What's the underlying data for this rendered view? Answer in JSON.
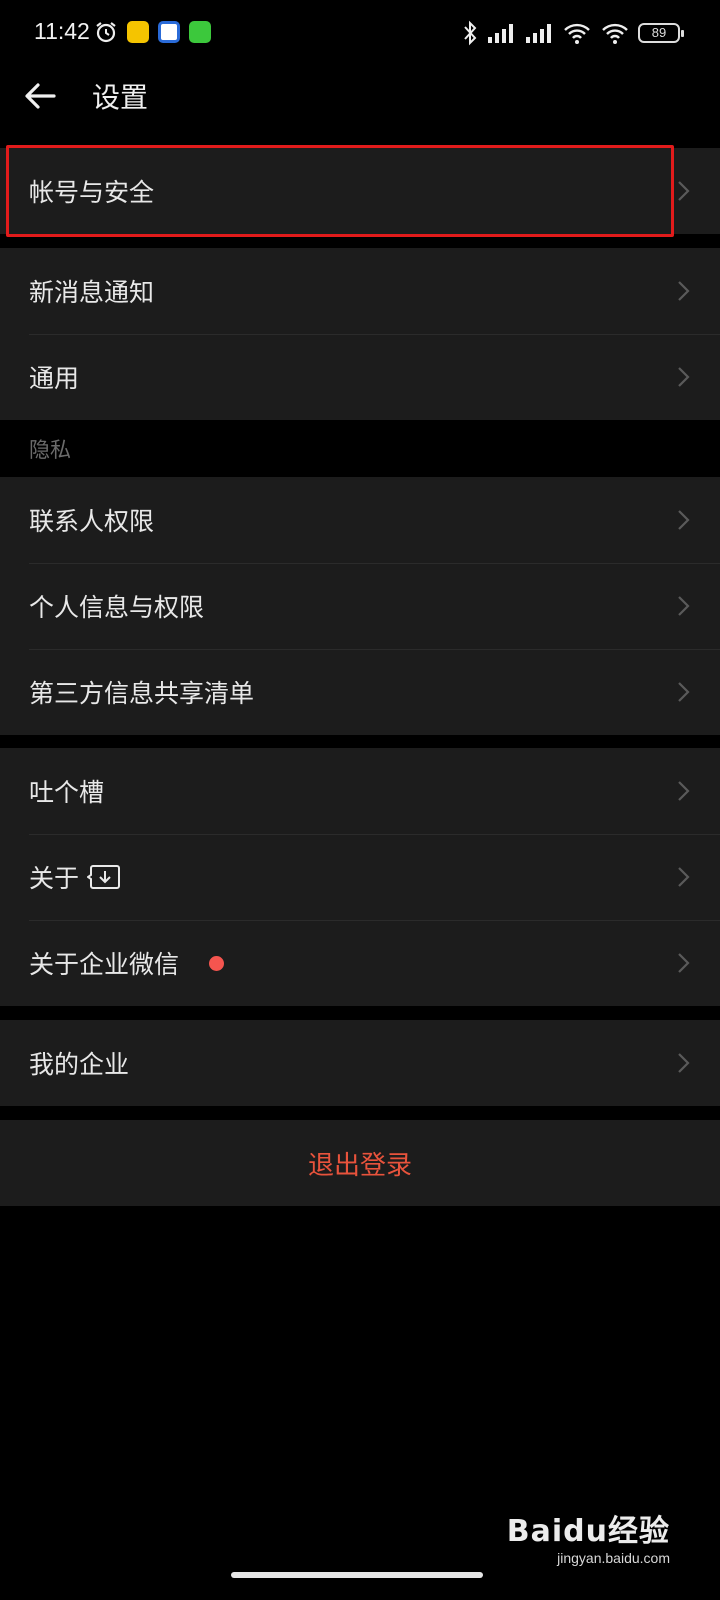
{
  "status_bar": {
    "time": "11:42",
    "battery": "89"
  },
  "header": {
    "title": "设置"
  },
  "groups": [
    {
      "items": [
        {
          "label": "帐号与安全"
        }
      ]
    },
    {
      "items": [
        {
          "label": "新消息通知"
        },
        {
          "label": "通用"
        }
      ]
    },
    {
      "section": "隐私",
      "items": [
        {
          "label": "联系人权限"
        },
        {
          "label": "个人信息与权限"
        },
        {
          "label": "第三方信息共享清单"
        }
      ]
    },
    {
      "items": [
        {
          "label": "吐个槽"
        },
        {
          "label": "关于"
        },
        {
          "label": "关于企业微信"
        }
      ]
    },
    {
      "items": [
        {
          "label": "我的企业"
        }
      ]
    }
  ],
  "logout": {
    "label": "退出登录"
  },
  "watermark": {
    "main": "Baidu经验",
    "sub": "jingyan.baidu.com"
  },
  "colors": {
    "accent_red": "#e8533c",
    "highlight": "#e11b1b",
    "dot": "#f5554f"
  }
}
